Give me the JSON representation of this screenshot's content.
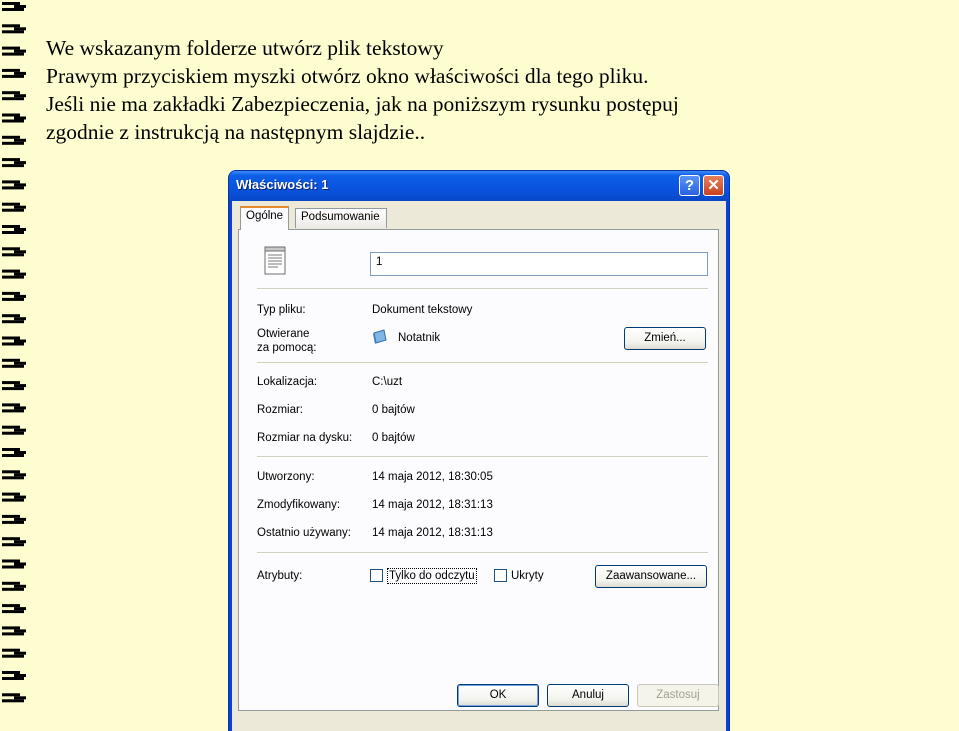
{
  "slide": {
    "lines": [
      "We wskazanym folderze utwórz plik tekstowy",
      "Prawym przyciskiem myszki otwórz okno właściwości dla tego pliku.",
      "Jeśli nie ma zakładki Zabezpieczenia, jak na poniższym rysunku postępuj",
      "zgodnie z instrukcją na następnym slajdzie.."
    ]
  },
  "dialog": {
    "title": "Właściwości: 1",
    "help_glyph": "?",
    "close_glyph": "✕",
    "tabs": [
      "Ogólne",
      "Podsumowanie"
    ],
    "file_name": "1",
    "fields": {
      "type_label": "Typ pliku:",
      "type_value": "Dokument tekstowy",
      "opens_label_1": "Otwierane",
      "opens_label_2": "za pomocą:",
      "opens_value": "Notatnik",
      "change_button": "Zmień...",
      "location_label": "Lokalizacja:",
      "location_value": "C:\\uzt",
      "size_label": "Rozmiar:",
      "size_value": "0 bajtów",
      "size_on_disk_label": "Rozmiar na dysku:",
      "size_on_disk_value": "0 bajtów",
      "created_label": "Utworzony:",
      "created_value": "14 maja 2012, 18:30:05",
      "modified_label": "Zmodyfikowany:",
      "modified_value": "14 maja 2012, 18:31:13",
      "accessed_label": "Ostatnio używany:",
      "accessed_value": "14 maja 2012, 18:31:13",
      "attributes_label": "Atrybuty:",
      "readonly_label": "Tylko do odczytu",
      "hidden_label": "Ukryty",
      "advanced_button": "Zaawansowane..."
    },
    "buttons": {
      "ok": "OK",
      "cancel": "Anuluj",
      "apply": "Zastosuj"
    }
  },
  "colors": {
    "slide_background": "#fdfdcf",
    "titlebar": "#0a53de",
    "dialog_face": "#ece9d8"
  }
}
